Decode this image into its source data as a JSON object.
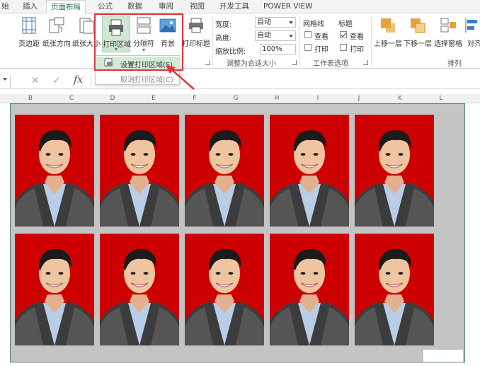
{
  "tabs": [
    "始",
    "插入",
    "页面布局",
    "公式",
    "数据",
    "审阅",
    "视图",
    "开发工具",
    "POWER VIEW"
  ],
  "active_tab": "页面布局",
  "ribbon": {
    "buttons": [
      {
        "label": "页边距",
        "icon": "margins-icon"
      },
      {
        "label": "纸张方向",
        "icon": "orientation-icon"
      },
      {
        "label": "纸张大小",
        "icon": "paper-size-icon"
      },
      {
        "label": "打印区域",
        "icon": "print-area-icon",
        "sub": "▾"
      },
      {
        "label": "分隔符",
        "icon": "breaks-icon",
        "sub": "▾"
      },
      {
        "label": "背景",
        "icon": "background-icon"
      },
      {
        "label": "打印标题",
        "icon": "print-titles-icon"
      }
    ],
    "truncated_group_label": "页",
    "scale": {
      "width_label": "宽度:",
      "width_value": "自动",
      "height_label": "高度:",
      "height_value": "自动",
      "zoom_label": "缩放比例:",
      "zoom_value": "100%",
      "group_label": "调整为合适大小"
    },
    "sheet_options": {
      "gridlines_title": "网格线",
      "headings_title": "标题",
      "view_label": "查看",
      "print_label": "打印",
      "gridlines_view": false,
      "gridlines_print": false,
      "headings_view": true,
      "headings_print": false,
      "group_label": "工作表选项"
    },
    "arrange": {
      "bring_forward": "上移一层",
      "send_backward": "下移一层",
      "selection_pane": "选择窗格",
      "align": "对齐",
      "group_label": "排列"
    }
  },
  "dropdown": {
    "set_print_area": "设置打印区域(S)",
    "clear_print_area": "取消打印区域(C)"
  },
  "formula_bar": {
    "cancel": "✕",
    "enter": "✓",
    "fx": "fx"
  },
  "columns": [
    "B",
    "C",
    "D",
    "E",
    "F",
    "G",
    "H",
    "I",
    "J",
    "K",
    "L"
  ],
  "photos": {
    "rows": 2,
    "cols": 5,
    "background": "#cc0000"
  },
  "colors": {
    "accent": "#217346",
    "highlight": "#e0353a",
    "photo_bg": "#cc0000",
    "sheet_border": "#4b8b6b"
  }
}
